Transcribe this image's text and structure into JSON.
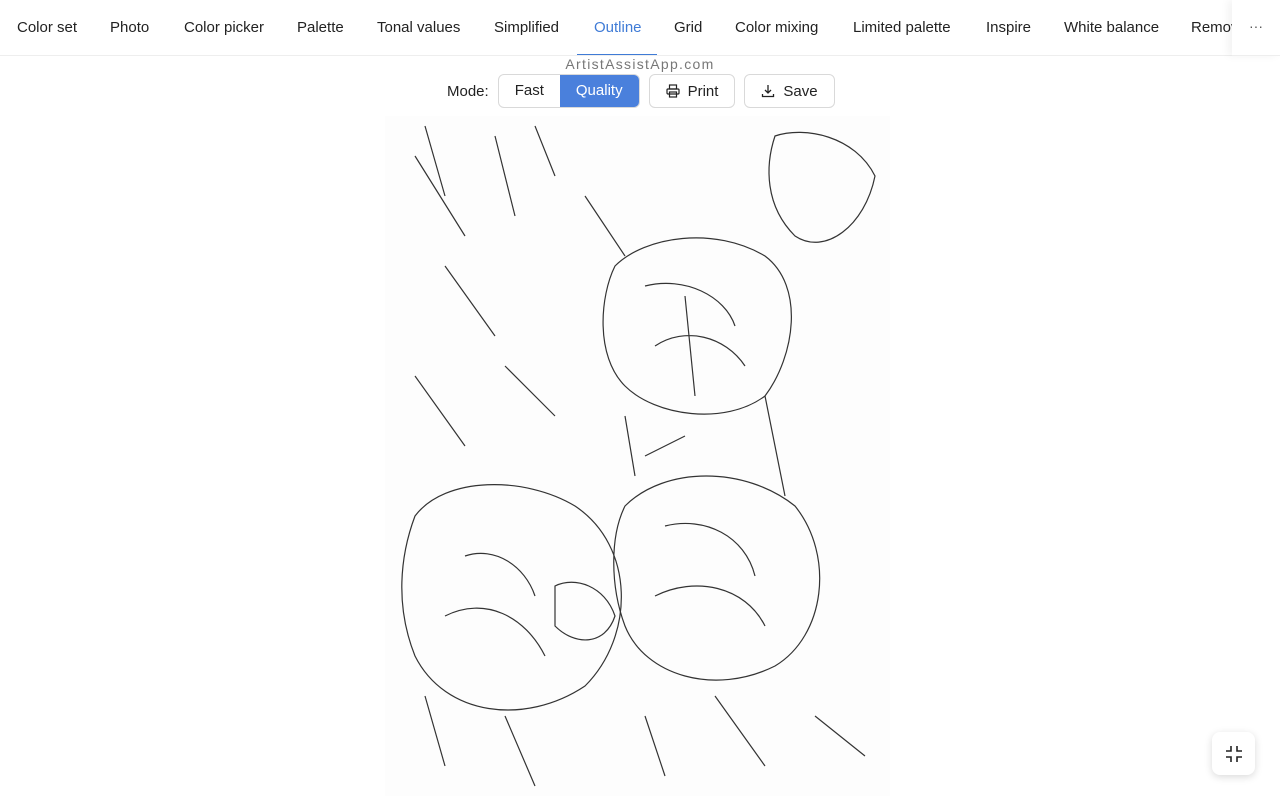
{
  "tabs": [
    {
      "label": "Color set",
      "active": false
    },
    {
      "label": "Photo",
      "active": false
    },
    {
      "label": "Color picker",
      "active": false
    },
    {
      "label": "Palette",
      "active": false
    },
    {
      "label": "Tonal values",
      "active": false
    },
    {
      "label": "Simplified",
      "active": false
    },
    {
      "label": "Outline",
      "active": true
    },
    {
      "label": "Grid",
      "active": false
    },
    {
      "label": "Color mixing",
      "active": false
    },
    {
      "label": "Limited palette",
      "active": false
    },
    {
      "label": "Inspire",
      "active": false
    },
    {
      "label": "White balance",
      "active": false
    },
    {
      "label": "Remov",
      "active": false
    }
  ],
  "more_label": "···",
  "watermark": "ArtistAssistApp.com",
  "toolbar": {
    "mode_label": "Mode:",
    "modes": [
      "Fast",
      "Quality"
    ],
    "selected_mode": "Quality",
    "print_label": "Print",
    "save_label": "Save"
  },
  "colors": {
    "accent": "#4a80dc"
  },
  "fab": {
    "icon": "fullscreen-exit-icon"
  }
}
